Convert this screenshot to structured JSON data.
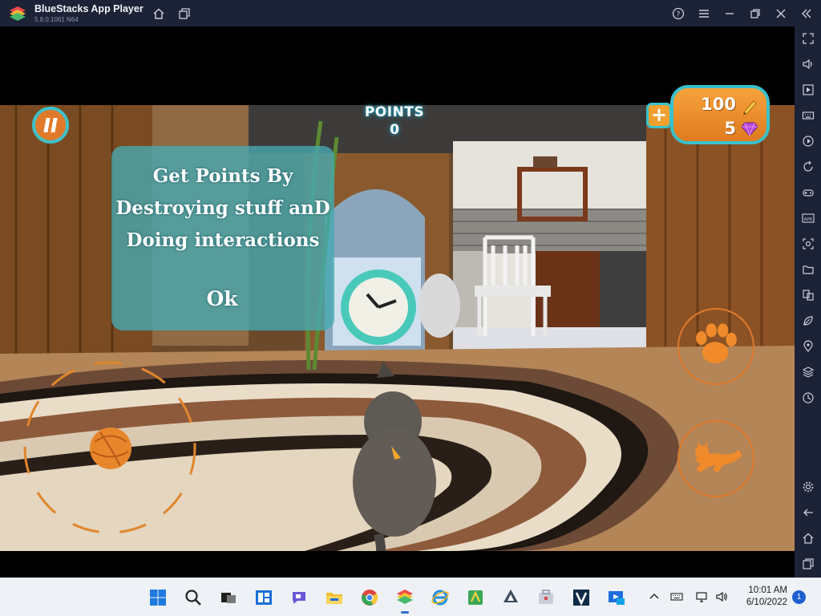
{
  "window": {
    "title": "BlueStacks App Player",
    "version": "5.8.0.1061 N64"
  },
  "titlebar_icons": [
    "home-icon",
    "multi-instance-icon",
    "help-icon",
    "menu-icon",
    "minimize-icon",
    "restore-icon",
    "close-icon",
    "collapse-sidebar-icon"
  ],
  "sidebar_icons": [
    "fullscreen-icon",
    "volume-icon",
    "media-icon",
    "keyboard-icon",
    "macro-icon",
    "rotate-icon",
    "controls-icon",
    "apk-icon",
    "screenshot-icon",
    "folder-icon",
    "multi-instance-icon",
    "eco-mode-icon",
    "location-icon",
    "layers-icon",
    "sync-icon",
    "settings-icon",
    "back-icon",
    "home-icon",
    "recent-apps-icon"
  ],
  "game": {
    "points_label": "POINTS",
    "points_value": "0",
    "coins": "100",
    "gems": "5",
    "dialog_message_line1": "Get Points By",
    "dialog_message_line2": "Destroying stuff anD",
    "dialog_message_line3": "Doing interactions",
    "dialog_ok": "Ok"
  },
  "taskbar": {
    "apps": [
      "windows-start-icon",
      "search-icon",
      "task-view-icon",
      "widgets-icon",
      "chat-icon",
      "file-explorer-icon",
      "chrome-icon",
      "bluestacks-icon",
      "internet-explorer-icon",
      "android-studio-icon",
      "inkscape-icon",
      "toolbox-icon",
      "v-app-icon",
      "video-player-icon"
    ],
    "time": "10:01 AM",
    "date": "6/10/2022",
    "notification_count": "1"
  },
  "colors": {
    "titlebar_bg": "#1d2336",
    "accent_orange": "#e07a2a",
    "accent_teal": "#39c1cb",
    "taskbar_bg": "#eef1f6"
  }
}
